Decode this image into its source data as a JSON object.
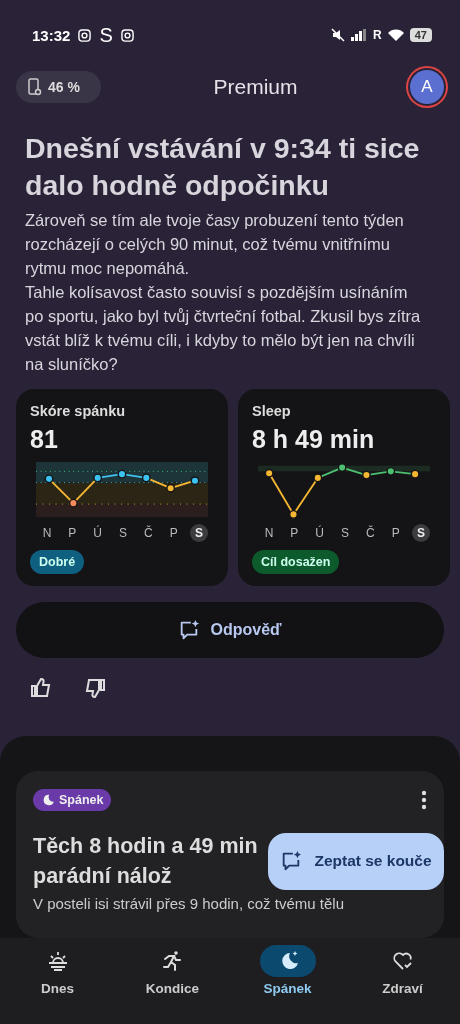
{
  "status_bar": {
    "time": "13:32",
    "app_letter": "S",
    "network_letter": "R",
    "battery": "47"
  },
  "header": {
    "device_battery": "46 %",
    "title": "Premium",
    "avatar": "A"
  },
  "insight": {
    "title": "Dnešní vstávání v 9:34 ti sice dalo hodně odpočinku",
    "paragraphs": [
      "Zároveň se tím ale tvoje časy probuzení tento týden rozcházejí o celých 90 minut, což tvému vnitřnímu rytmu moc nepomáhá.",
      "Tahle kolísavost často souvisí s pozdějším usínáním po sportu, jako byl tvůj čtvrteční fotbal. Zkusil bys zítra vstát blíž k tvému cíli, i kdyby to mělo být jen na chvíli na sluníčko?"
    ]
  },
  "metrics": [
    {
      "kind": "score",
      "label": "Skóre spánku",
      "value": "81",
      "badge": "Dobré",
      "color": "#0f5f80",
      "days": [
        {
          "label": "N",
          "selected": false
        },
        {
          "label": "P",
          "selected": false
        },
        {
          "label": "Ú",
          "selected": false
        },
        {
          "label": "S",
          "selected": false
        },
        {
          "label": "Č",
          "selected": false
        },
        {
          "label": "P",
          "selected": false
        },
        {
          "label": "S",
          "selected": true
        }
      ]
    },
    {
      "kind": "duration",
      "label": "Sleep",
      "value": "8 h 49 min",
      "badge": "Cíl dosažen",
      "color": "#0d5a2c",
      "days": [
        {
          "label": "N",
          "selected": false
        },
        {
          "label": "P",
          "selected": false
        },
        {
          "label": "Ú",
          "selected": false
        },
        {
          "label": "S",
          "selected": false
        },
        {
          "label": "Č",
          "selected": false
        },
        {
          "label": "P",
          "selected": false
        },
        {
          "label": "S",
          "selected": true
        }
      ]
    }
  ],
  "reply_button": "Odpověď",
  "feed_card": {
    "tag": "Spánek",
    "title": "Těch 8 hodin a 49 min parádní nálož",
    "text": "V posteli isi strávil přes 9 hodin, což tvému tělu"
  },
  "coach_button": "Zeptat se kouče",
  "nav": [
    {
      "kind": "today",
      "label": "Dnes",
      "selected": false
    },
    {
      "kind": "fitness",
      "label": "Kondice",
      "selected": false
    },
    {
      "kind": "sleep",
      "label": "Spánek",
      "selected": true
    },
    {
      "kind": "health",
      "label": "Zdraví",
      "selected": false
    }
  ]
}
